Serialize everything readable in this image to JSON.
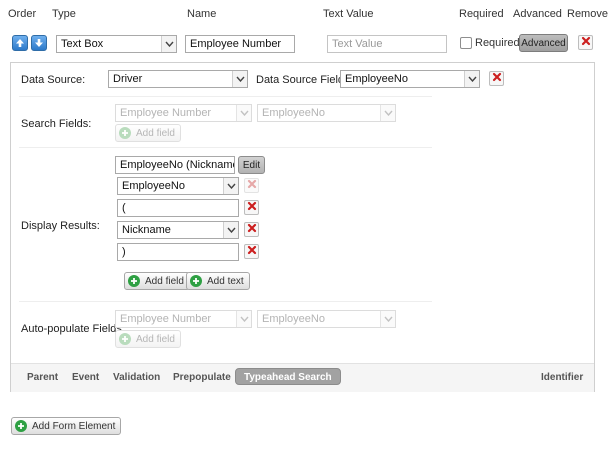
{
  "headers": {
    "order": "Order",
    "type": "Type",
    "name": "Name",
    "text_value": "Text Value",
    "required": "Required",
    "advanced": "Advanced",
    "remove": "Remove"
  },
  "element_row": {
    "type_value": "Text Box",
    "name_value": "Employee Number",
    "text_value_placeholder": "Text Value",
    "required_label": "Required",
    "required_checked": false,
    "advanced_button": "Advanced"
  },
  "panel": {
    "data_source_label": "Data Source:",
    "data_source_value": "Driver",
    "data_source_field_label": "Data Source Field:",
    "data_source_field_value": "EmployeeNo",
    "search_fields_label": "Search Fields:",
    "search_fields": {
      "field_value": "Employee Number",
      "column_value": "EmployeeNo",
      "add_field": "Add field"
    },
    "display_results_label": "Display Results:",
    "display_results": {
      "template_value": "EmployeeNo (Nickname)",
      "edit_button": "Edit",
      "items": [
        {
          "kind": "select",
          "value": "EmployeeNo",
          "removable": false
        },
        {
          "kind": "text",
          "value": "(",
          "removable": true
        },
        {
          "kind": "select",
          "value": "Nickname",
          "removable": true
        },
        {
          "kind": "text",
          "value": ")",
          "removable": true
        }
      ],
      "add_field": "Add field",
      "add_text": "Add text"
    },
    "auto_populate_label": "Auto-populate Fields:",
    "auto_populate": {
      "field_value": "Employee Number",
      "column_value": "EmployeeNo",
      "add_field": "Add field"
    }
  },
  "tabs": [
    {
      "label": "Parent",
      "active": false
    },
    {
      "label": "Event",
      "active": false
    },
    {
      "label": "Validation",
      "active": false
    },
    {
      "label": "Prepopulate",
      "active": false
    },
    {
      "label": "Typeahead Search",
      "active": true
    }
  ],
  "identifier_label": "Identifier",
  "add_form_element": "Add Form Element",
  "colors": {
    "remove_red": "#cc1f1f",
    "add_green": "#2ea043",
    "arrow_blue": "#2d79c9",
    "active_tab": "#a2a2a2"
  },
  "icons": {
    "move_up": "arrow-up-icon",
    "move_down": "arrow-down-icon",
    "remove": "close-icon",
    "add": "plus-icon",
    "dropdown": "chevron-down-icon"
  }
}
